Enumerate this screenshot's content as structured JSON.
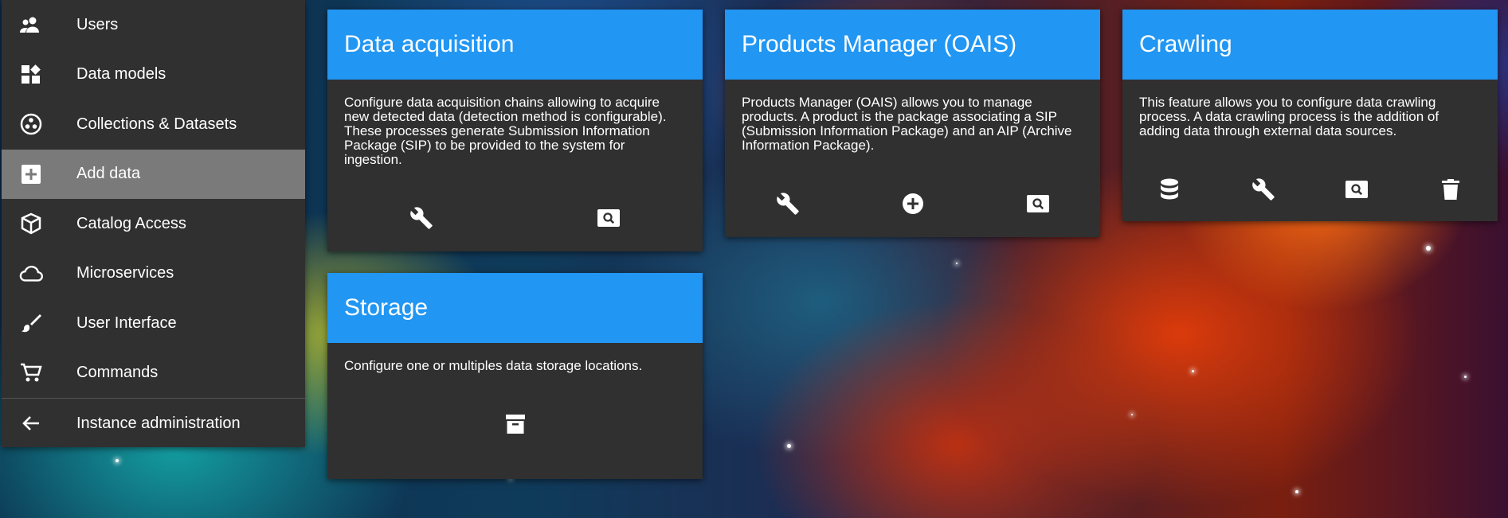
{
  "sidebar": {
    "items": [
      {
        "label": "Users",
        "icon": "users-icon"
      },
      {
        "label": "Data models",
        "icon": "data-models-icon"
      },
      {
        "label": "Collections & Datasets",
        "icon": "collections-icon"
      },
      {
        "label": "Add data",
        "icon": "add-box-icon",
        "active": true
      },
      {
        "label": "Catalog Access",
        "icon": "catalog-icon"
      },
      {
        "label": "Microservices",
        "icon": "cloud-icon"
      },
      {
        "label": "User Interface",
        "icon": "brush-icon"
      },
      {
        "label": "Commands",
        "icon": "cart-icon"
      },
      {
        "label": "Instance administration",
        "icon": "arrow-back-icon"
      }
    ]
  },
  "cards": {
    "acquisition": {
      "title": "Data acquisition",
      "description": "Configure data acquisition chains allowing to acquire new detected data (detection method is configurable). These processes generate Submission Information Package (SIP) to be provided to the system for ingestion.",
      "actions": [
        "wrench-icon",
        "search-icon"
      ]
    },
    "oais": {
      "title": "Products Manager (OAIS)",
      "description": "Products Manager (OAIS) allows you to manage products. A product is the package associating a SIP (Submission Information Package) and an AIP (Archive Information Package).",
      "actions": [
        "wrench-icon",
        "add-circle-icon",
        "search-icon"
      ]
    },
    "crawling": {
      "title": "Crawling",
      "description": "This feature allows you to configure data crawling process. A data crawling process is the addition of adding data through external data sources.",
      "actions": [
        "database-icon",
        "wrench-icon",
        "search-icon",
        "delete-icon"
      ]
    },
    "storage": {
      "title": "Storage",
      "description": "Configure one or multiples data storage locations.",
      "actions": [
        "archive-icon"
      ]
    }
  },
  "colors": {
    "sidebar_bg": "#303030",
    "active_item_bg": "#7a7a7a",
    "card_bg": "#303030",
    "card_header": "#2196f3"
  }
}
